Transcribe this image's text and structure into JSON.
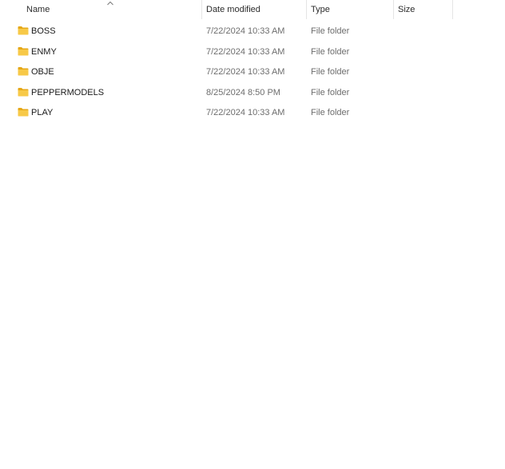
{
  "columns": {
    "name": "Name",
    "date_modified": "Date modified",
    "type": "Type",
    "size": "Size"
  },
  "sort": {
    "column": "name",
    "direction": "ascending",
    "icon": "chevron-up-icon"
  },
  "folder_icon": {
    "name": "folder-icon",
    "color": "#f7c948",
    "tab_color": "#e6a817"
  },
  "files": [
    {
      "name": "BOSS",
      "date_modified": "7/22/2024 10:33 AM",
      "type": "File folder",
      "size": ""
    },
    {
      "name": "ENMY",
      "date_modified": "7/22/2024 10:33 AM",
      "type": "File folder",
      "size": ""
    },
    {
      "name": "OBJE",
      "date_modified": "7/22/2024 10:33 AM",
      "type": "File folder",
      "size": ""
    },
    {
      "name": "PEPPERMODELS",
      "date_modified": "8/25/2024 8:50 PM",
      "type": "File folder",
      "size": ""
    },
    {
      "name": "PLAY",
      "date_modified": "7/22/2024 10:33 AM",
      "type": "File folder",
      "size": ""
    }
  ]
}
